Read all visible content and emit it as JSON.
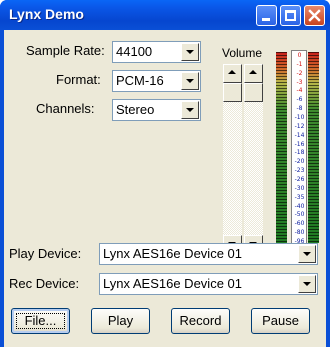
{
  "window": {
    "title": "Lynx Demo"
  },
  "settings": {
    "sample_rate_label": "Sample Rate:",
    "sample_rate_value": "44100",
    "format_label": "Format:",
    "format_value": "PCM-16",
    "channels_label": "Channels:",
    "channels_value": "Stereo"
  },
  "volume": {
    "label": "Volume",
    "left_level": 1.0,
    "right_level": 1.0
  },
  "meters": {
    "scale": [
      "0",
      "-1",
      "-2",
      "-3",
      "-4",
      "-6",
      "-8",
      "-10",
      "-12",
      "-14",
      "-16",
      "-18",
      "-20",
      "-23",
      "-26",
      "-30",
      "-35",
      "-40",
      "-50",
      "-60",
      "-80",
      "-96"
    ],
    "red_ticks": [
      "0",
      "-1",
      "-2",
      "-3",
      "-4"
    ],
    "left_level": 1.0,
    "right_level": 1.0
  },
  "devices": {
    "play_label": "Play Device:",
    "play_value": "Lynx AES16e Device 01",
    "rec_label": "Rec Device:",
    "rec_value": "Lynx AES16e Device 01"
  },
  "buttons": {
    "file": "File...",
    "play": "Play",
    "record": "Record",
    "pause": "Pause"
  },
  "colors": {
    "titlebar": "#0a57e8",
    "client_bg": "#ece9d8",
    "meter_red": "#c8201c",
    "meter_green": "#1f7a22",
    "tick_red": "#d01010",
    "tick_blue": "#1020a0"
  },
  "icons": {
    "minimize": "minimize-icon",
    "maximize": "maximize-icon",
    "close": "close-icon"
  }
}
